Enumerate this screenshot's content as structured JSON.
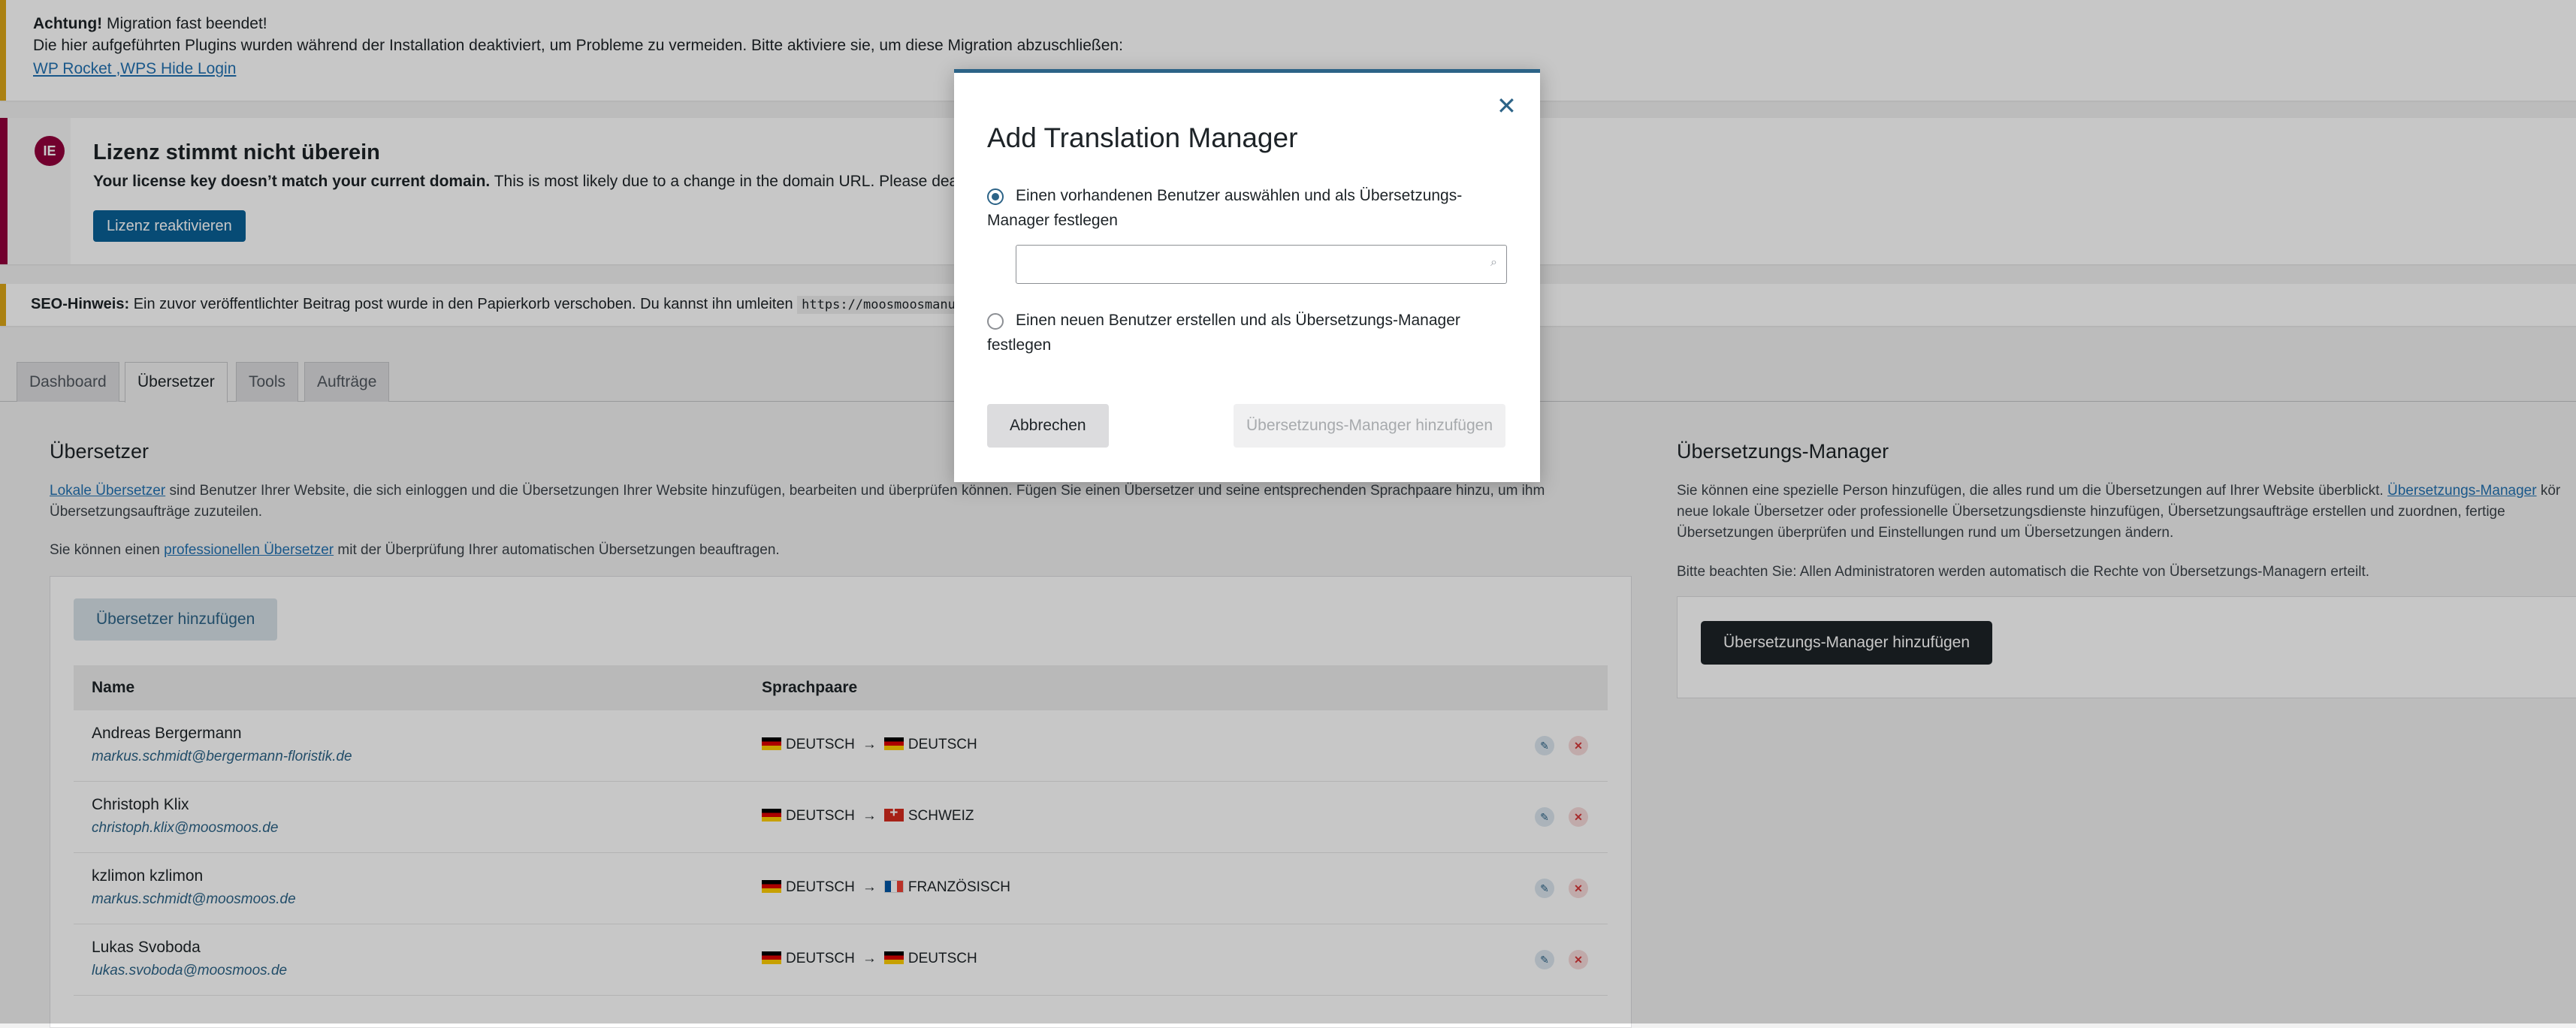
{
  "notices": {
    "migration": {
      "strong": "Achtung!",
      "title": "Migration fast beendet!",
      "text": "Die hier aufgeführten Plugins wurden während der Installation deaktiviert, um Probleme zu vermeiden. Bitte aktiviere sie, um diese Migration abzuschließen:",
      "links": "WP Rocket ,WPS Hide Login"
    },
    "license": {
      "icon": "elementor-logo-icon",
      "title": "Lizenz stimmt nicht überein",
      "text_strong": "Your license key doesn’t match your current domain.",
      "text": "This is most likely due to a change in the domain URL. Please deactivate th",
      "button": "Lizenz reaktivieren"
    },
    "seo": {
      "strong": "SEO-Hinweis:",
      "text": "Ein zuvor veröffentlichter Beitrag post wurde in den Papierkorb verschoben. Du kannst ihn umleiten",
      "code": "https://moosmoosmanufa"
    }
  },
  "tabs": [
    "Dashboard",
    "Übersetzer",
    "Tools",
    "Aufträge"
  ],
  "translators": {
    "title": "Übersetzer",
    "intro_link": "Lokale Übersetzer",
    "intro_rest": "sind Benutzer Ihrer Website, die sich einloggen und die Übersetzungen Ihrer Website hinzufügen, bearbeiten und überprüfen können. Fügen Sie einen Übersetzer und seine entsprechenden Sprachpaare hinzu, um ihm",
    "intro_line2": "Übersetzungsaufträge zuzuteilen.",
    "pro_pre": "Sie können einen",
    "pro_link": "professionellen Übersetzer",
    "pro_post": "mit der Überprüfung Ihrer automatischen Übersetzungen beauftragen.",
    "add_button": "Übersetzer hinzufügen",
    "col_name": "Name",
    "col_pairs": "Sprachpaare",
    "rows": [
      {
        "name": "Andreas Bergermann",
        "email": "markus.schmidt@bergermann-floristik.de",
        "from": "DEUTSCH",
        "to": "DEUTSCH"
      },
      {
        "name": "Christoph Klix",
        "email": "christoph.klix@moosmoos.de",
        "from": "DEUTSCH",
        "to": "SCHWEIZ"
      },
      {
        "name": "kzlimon kzlimon",
        "email": "markus.schmidt@moosmoos.de",
        "from": "DEUTSCH",
        "to": "FRANZÖSISCH"
      },
      {
        "name": "Lukas Svoboda",
        "email": "lukas.svoboda@moosmoos.de",
        "from": "DEUTSCH",
        "to": "DEUTSCH"
      }
    ]
  },
  "manager": {
    "title": "Übersetzungs-Manager",
    "text_pre": "Sie können eine spezielle Person hinzufügen, die alles rund um die Übersetzungen auf Ihrer Website überblickt.",
    "text_link": "Übersetzungs-Manager",
    "text_post": "kör",
    "text_line2": "neue lokale Übersetzer oder professionelle Übersetzungsdienste hinzufügen, Übersetzungsaufträge erstellen und zuordnen, fertige",
    "text_line3": "Übersetzungen überprüfen und Einstellungen rund um Übersetzungen ändern.",
    "note": "Bitte beachten Sie: Allen Administratoren werden automatisch die Rechte von Übersetzungs-Managern erteilt.",
    "button": "Übersetzungs-Manager hinzufügen"
  },
  "modal": {
    "title": "Add Translation Manager",
    "option1_line1": "Einen vorhandenen Benutzer auswählen und als Übersetzungs-",
    "option1_line2": "Manager festlegen",
    "option2_line1": "Einen neuen Benutzer erstellen und als Übersetzungs-Manager",
    "option2_line2": "festlegen",
    "search_value": "",
    "cancel": "Abbrechen",
    "confirm": "Übersetzungs-Manager hinzufügen"
  },
  "arrow": "→"
}
